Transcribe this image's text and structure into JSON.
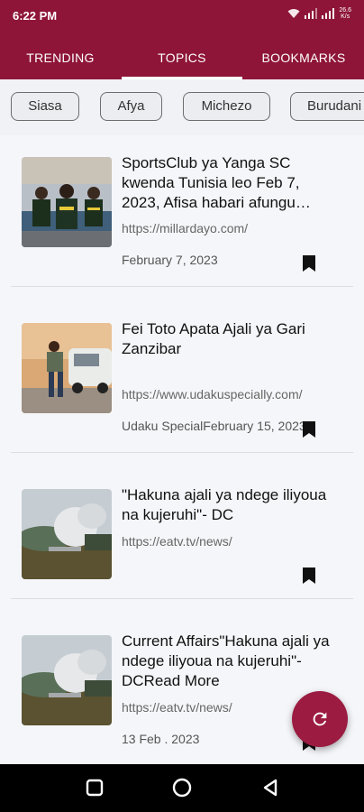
{
  "status_bar": {
    "time": "6:22 PM",
    "net_speed_value": "26.6",
    "net_speed_unit": "K/s",
    "icons": [
      "wifi-icon",
      "signal-icon",
      "signal-icon",
      "network-speed"
    ]
  },
  "tabs": [
    {
      "label": "TRENDING",
      "active": false
    },
    {
      "label": "TOPICS",
      "active": true
    },
    {
      "label": "BOOKMARKS",
      "active": false
    }
  ],
  "chips": [
    {
      "label": "Siasa"
    },
    {
      "label": "Afya"
    },
    {
      "label": "Michezo"
    },
    {
      "label": "Burudani"
    }
  ],
  "articles": [
    {
      "title": "SportsClub ya Yanga SC kwenda Tunisia leo Feb 7, 2023, Afisa habari afungu…",
      "url": "https://millardayo.com/",
      "meta": "February 7, 2023",
      "thumbnail": "football-team-photo"
    },
    {
      "title": "Fei Toto Apata Ajali ya Gari Zanzibar",
      "url": "https://www.udakuspecially.com/",
      "meta": "Udaku SpecialFebruary 15, 2023",
      "thumbnail": "man-by-car-photo"
    },
    {
      "title": "\"Hakuna ajali ya ndege iliyoua na kujeruhi\"- DC",
      "url": "https://eatv.tv/news/",
      "meta": "",
      "thumbnail": "plane-crash-smoke-photo"
    },
    {
      "title": "Current  Affairs\"Hakuna ajali ya ndege iliyoua na kujeruhi\"- DCRead More",
      "url": "https://eatv.tv/news/",
      "meta": "13 Feb .  2023",
      "thumbnail": "plane-crash-smoke-photo"
    }
  ],
  "fab": {
    "icon": "refresh-icon"
  },
  "colors": {
    "primary": "#8e1538",
    "fab": "#9b1b41",
    "chip_border": "#6d6d6d",
    "background": "#f5f6f9"
  },
  "navbar": {
    "icons": [
      "recents-square-icon",
      "home-circle-icon",
      "back-triangle-icon"
    ]
  }
}
